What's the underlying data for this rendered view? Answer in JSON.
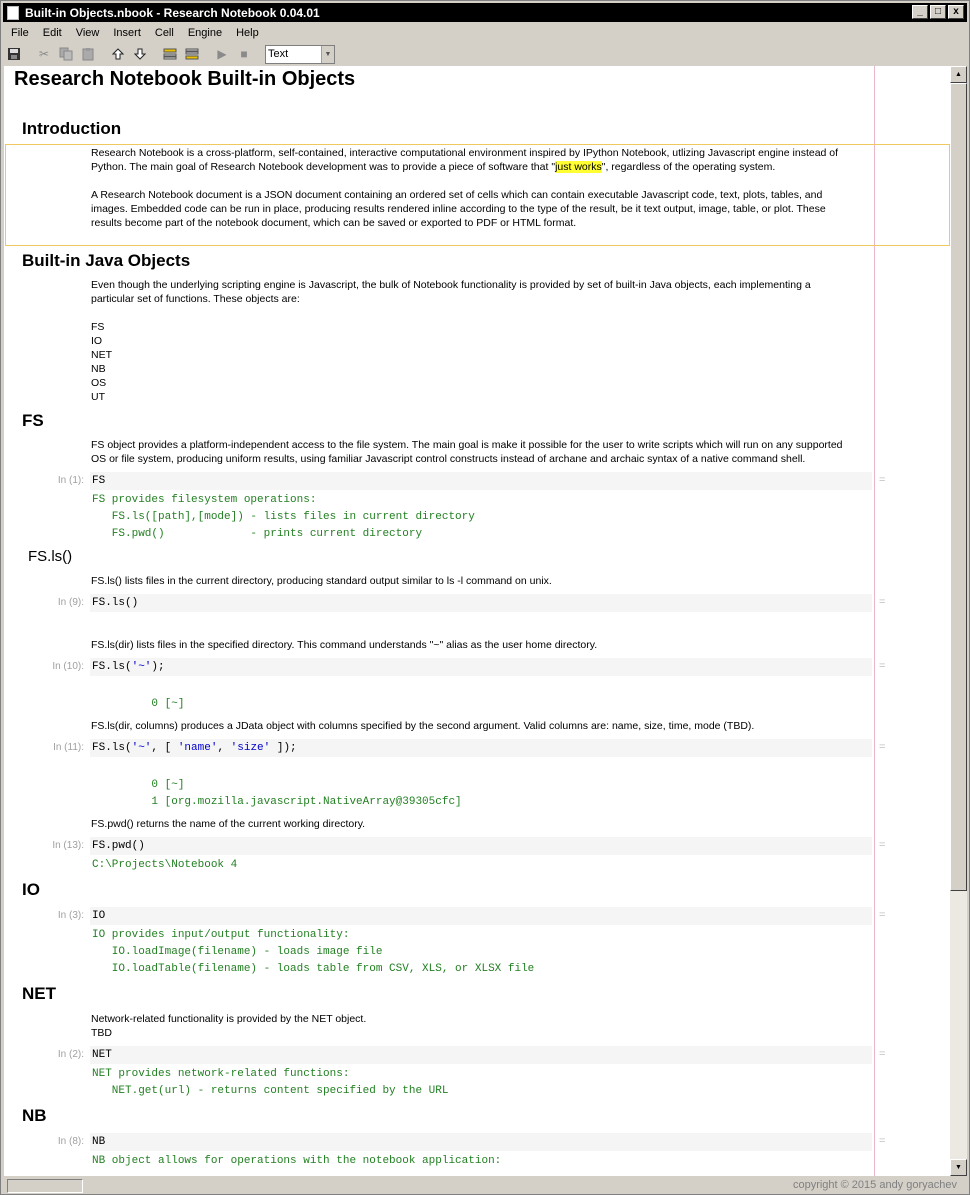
{
  "window": {
    "title": "Built-in Objects.nbook  - Research Notebook 0.04.01",
    "buttons": [
      "_",
      "□",
      "x"
    ]
  },
  "menu": [
    "File",
    "Edit",
    "View",
    "Insert",
    "Cell",
    "Engine",
    "Help"
  ],
  "toolbar": {
    "cell_type": "Text"
  },
  "doc": {
    "title": "Research Notebook Built-in Objects",
    "intro_heading": "Introduction",
    "intro_p1a": "Research Notebook is a cross-platform, self-contained, interactive computational environment inspired by IPython Notebook, utlizing Javascript engine instead of",
    "intro_p1b_pre": "Python.  The main goal of Research Notebook development was to provide a piece of software that \"",
    "intro_p1b_hl": "just works",
    "intro_p1b_post": "\", regardless of the operating system.",
    "intro_p2a": "A Research Notebook document is a JSON document containing an ordered set of cells which can contain executable Javascript code, text, plots, tables, and",
    "intro_p2b": "images.  Embedded code can be run in place, producing results rendered inline according to the type of the result, be it text output, image, table, or plot.  These",
    "intro_p2c": "results become part of the notebook document, which can be saved or exported to PDF or HTML format.",
    "java_heading": "Built-in Java Objects",
    "java_p1a": "Even though the underlying scripting engine is Javascript, the bulk of Notebook functionality is provided by set of built-in Java objects, each implementing a",
    "java_p1b": "particular set of functions.  These objects are:",
    "objects": [
      "FS",
      "IO",
      "NET",
      "NB",
      "OS",
      "UT"
    ],
    "fs_heading": "FS",
    "fs_p1a": "FS object provides a platform-independent access to the file system.  The main goal is make it possible for the user to write scripts which will run on any supported",
    "fs_p1b": "OS or file system, producing uniform results, using familiar Javascript control constructs instead of archane and archaic syntax of a native command shell.",
    "cell1_label": "In (1):",
    "cell1_code": "FS",
    "cell1_out": "FS provides filesystem operations:\n   FS.ls([path],[mode]) - lists files in current directory\n   FS.pwd()             - prints current directory",
    "fsls_heading": "FS.ls()",
    "fsls_p1": "FS.ls() lists files in the current directory, producing standard output similar to ls -l command on unix.",
    "cell9_label": "In (9):",
    "cell9_code": "FS.ls()",
    "fsls_p2": "FS.ls(dir) lists files in the specified directory.  This command understands \"~\" alias as the user home directory.",
    "cell10_label": "In (10):",
    "cell10_code_a": "FS.ls(",
    "cell10_code_b": "'~'",
    "cell10_code_c": ");",
    "cell10_out": "         0 [~]",
    "fsls_p3": "FS.ls(dir, columns) produces a JData object with columns specified by the second argument.  Valid columns are: name, size, time, mode (TBD).",
    "cell11_label": "In (11):",
    "cell11_code_a": "FS.ls(",
    "cell11_code_b": "'~'",
    "cell11_code_c": ", [ ",
    "cell11_code_d": "'name'",
    "cell11_code_e": ", ",
    "cell11_code_f": "'size'",
    "cell11_code_g": " ]);",
    "cell11_out": "         0 [~]\n         1 [org.mozilla.javascript.NativeArray@39305cfc]",
    "fspwd_p": "FS.pwd() returns the name of the current working directory.",
    "cell13_label": "In (13):",
    "cell13_code": "FS.pwd()",
    "cell13_out": "C:\\Projects\\Notebook 4",
    "io_heading": "IO",
    "cell3_label": "In (3):",
    "cell3_code": "IO",
    "cell3_out": "IO provides input/output functionality:\n   IO.loadImage(filename) - loads image file\n   IO.loadTable(filename) - loads table from CSV, XLS, or XLSX file",
    "net_heading": "NET",
    "net_p1": "Network-related functionality is provided by the NET object.",
    "net_p2": "TBD",
    "cell2_label": "In (2):",
    "cell2_code": "NET",
    "cell2_out": "NET provides network-related functions:\n   NET.get(url) - returns content specified by the URL",
    "nb_heading": "NB",
    "cell8_label": "In (8):",
    "cell8_code": "NB",
    "cell8_out": "NB object allows for operations with the notebook application:",
    "eq": "="
  },
  "status": {
    "copyright": "copyright © 2015 andy goryachev"
  }
}
